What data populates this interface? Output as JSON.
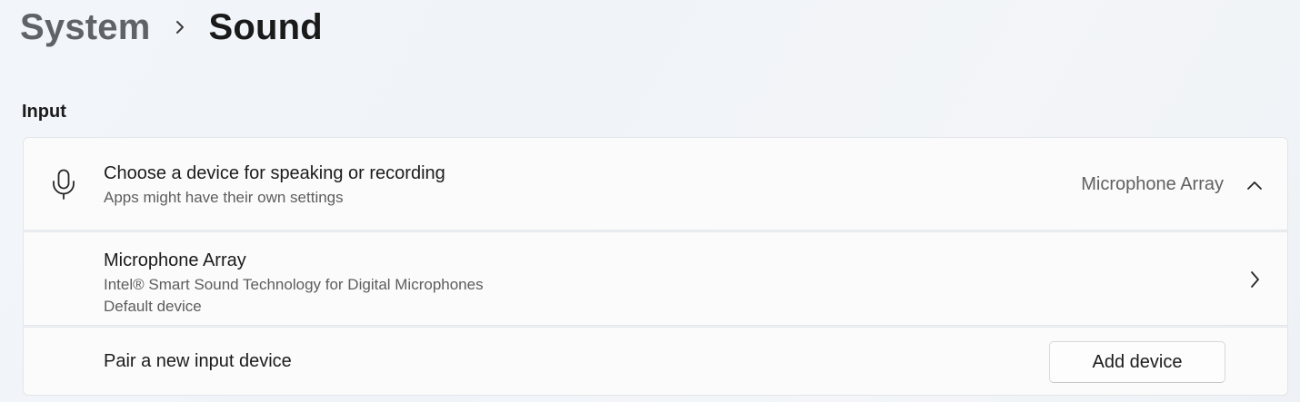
{
  "breadcrumb": {
    "parent": "System",
    "current": "Sound"
  },
  "section": {
    "title": "Input"
  },
  "device_chooser": {
    "title": "Choose a device for speaking or recording",
    "subtitle": "Apps might have their own settings",
    "selected_value": "Microphone Array",
    "expanded": true,
    "icon": "microphone-icon"
  },
  "device_item": {
    "name": "Microphone Array",
    "description": "Intel® Smart Sound Technology for Digital Microphones",
    "status": "Default device",
    "icon": "chevron-right-icon"
  },
  "pair_row": {
    "label": "Pair a new input device",
    "button_label": "Add device"
  }
}
